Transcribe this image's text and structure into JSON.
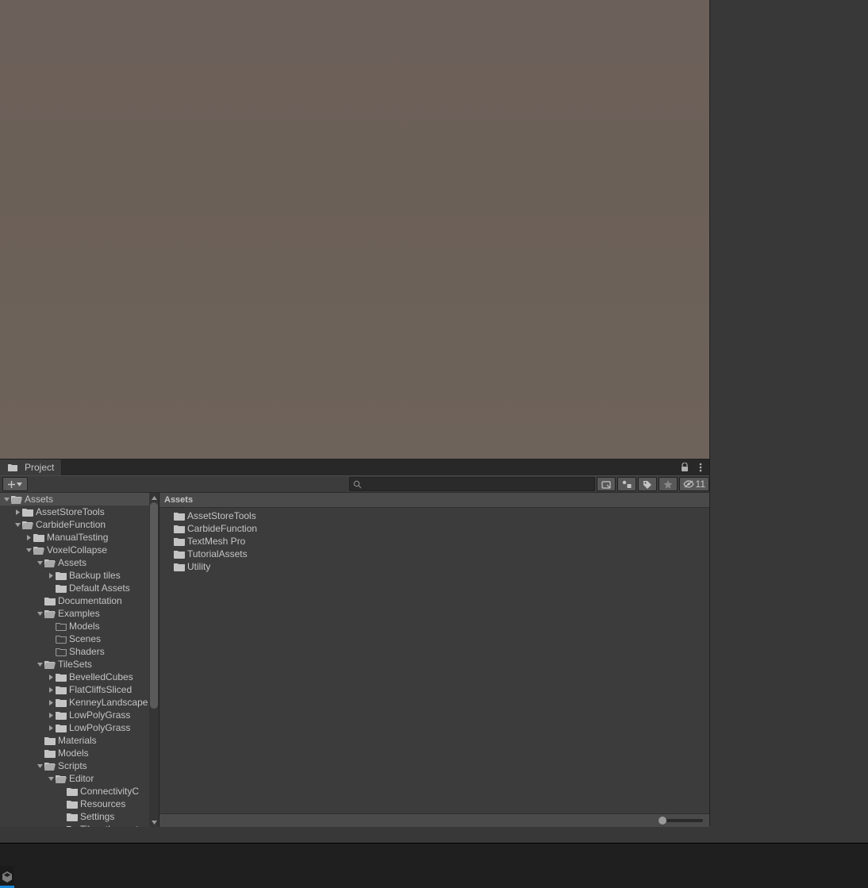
{
  "tabs": {
    "project": "Project"
  },
  "toolbar": {
    "hidden_count": "11"
  },
  "search": {
    "placeholder": ""
  },
  "breadcrumb": "Assets",
  "content_items": [
    "AssetStoreTools",
    "CarbideFunction",
    "TextMesh Pro",
    "TutorialAssets",
    "Utility"
  ],
  "tree": [
    {
      "d": 0,
      "label": "Assets",
      "exp": "open",
      "sel": true,
      "ico": "folder-open"
    },
    {
      "d": 1,
      "label": "AssetStoreTools",
      "exp": "closed",
      "ico": "folder"
    },
    {
      "d": 1,
      "label": "CarbideFunction",
      "exp": "open",
      "ico": "folder-open"
    },
    {
      "d": 2,
      "label": "ManualTesting",
      "exp": "closed",
      "ico": "folder"
    },
    {
      "d": 2,
      "label": "VoxelCollapse",
      "exp": "open",
      "ico": "folder-open"
    },
    {
      "d": 3,
      "label": "Assets",
      "exp": "open",
      "ico": "folder-open"
    },
    {
      "d": 4,
      "label": "Backup tiles",
      "exp": "closed",
      "ico": "folder"
    },
    {
      "d": 4,
      "label": "Default Assets",
      "exp": "none",
      "ico": "folder"
    },
    {
      "d": 3,
      "label": "Documentation",
      "exp": "none",
      "ico": "folder"
    },
    {
      "d": 3,
      "label": "Examples",
      "exp": "open",
      "ico": "folder-open"
    },
    {
      "d": 4,
      "label": "Models",
      "exp": "none",
      "ico": "folder-outline"
    },
    {
      "d": 4,
      "label": "Scenes",
      "exp": "none",
      "ico": "folder-outline"
    },
    {
      "d": 4,
      "label": "Shaders",
      "exp": "none",
      "ico": "folder-outline"
    },
    {
      "d": 3,
      "label": "TileSets",
      "exp": "open",
      "ico": "folder-open"
    },
    {
      "d": 4,
      "label": "BevelledCubes",
      "exp": "closed",
      "ico": "folder"
    },
    {
      "d": 4,
      "label": "FlatCliffsSliced",
      "exp": "closed",
      "ico": "folder"
    },
    {
      "d": 4,
      "label": "KenneyLandscape",
      "exp": "closed",
      "ico": "folder"
    },
    {
      "d": 4,
      "label": "LowPolyGrass",
      "exp": "closed",
      "ico": "folder"
    },
    {
      "d": 4,
      "label": "LowPolyGrass",
      "exp": "closed",
      "ico": "folder"
    },
    {
      "d": 3,
      "label": "Materials",
      "exp": "none",
      "ico": "folder"
    },
    {
      "d": 3,
      "label": "Models",
      "exp": "none",
      "ico": "folder"
    },
    {
      "d": 3,
      "label": "Scripts",
      "exp": "open",
      "ico": "folder-open"
    },
    {
      "d": 4,
      "label": "Editor",
      "exp": "open",
      "ico": "folder-open"
    },
    {
      "d": 5,
      "label": "ConnectivityC",
      "exp": "none",
      "ico": "folder"
    },
    {
      "d": 5,
      "label": "Resources",
      "exp": "none",
      "ico": "folder"
    },
    {
      "d": 5,
      "label": "Settings",
      "exp": "none",
      "ico": "folder"
    },
    {
      "d": 5,
      "label": "TilesetInspector",
      "exp": "none",
      "ico": "folder"
    }
  ]
}
